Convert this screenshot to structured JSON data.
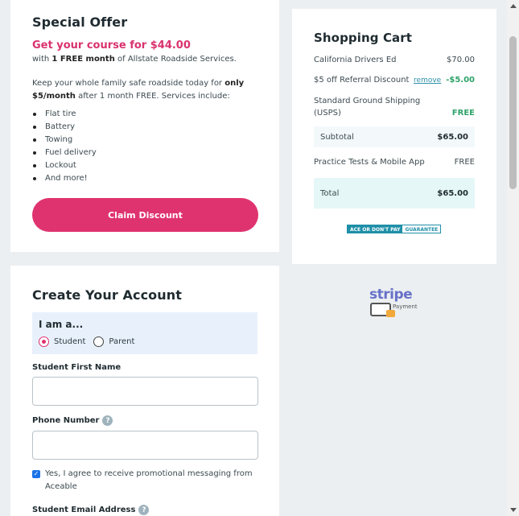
{
  "offer": {
    "title": "Special Offer",
    "price_line": "Get your course for $44.00",
    "sub_prefix": "with ",
    "sub_bold": "1 FREE month",
    "sub_suffix": " of Allstate Roadside Services.",
    "body_prefix": "Keep your whole family safe roadside today for ",
    "body_bold": "only $5/month",
    "body_suffix": " after 1 month FREE. Services include:",
    "services": [
      "Flat tire",
      "Battery",
      "Towing",
      "Fuel delivery",
      "Lockout",
      "And more!"
    ],
    "button_label": "Claim Discount"
  },
  "cart": {
    "title": "Shopping Cart",
    "item_name": "California Drivers Ed",
    "item_price": "$70.00",
    "referral_label": "$5 off Referral Discount",
    "remove_label": "remove",
    "referral_amount": "-$5.00",
    "shipping_label": "Standard Ground Shipping (USPS)",
    "shipping_amount": "FREE",
    "subtotal_label": "Subtotal",
    "subtotal_amount": "$65.00",
    "practice_label": "Practice Tests & Mobile App",
    "practice_amount": "FREE",
    "total_label": "Total",
    "total_amount": "$65.00",
    "guarantee_left": "ACE OR DON'T PAY",
    "guarantee_right": "GUARANTEE"
  },
  "stripe": {
    "logo_text": "stripe",
    "payment_label": "Payment"
  },
  "account": {
    "title": "Create Your Account",
    "iam_label": "I am a...",
    "role_student": "Student",
    "role_parent": "Parent",
    "first_name_label": "Student First Name",
    "first_name_value": "",
    "phone_label": "Phone Number",
    "phone_value": "",
    "help_glyph": "?",
    "consent_text": "Yes, I agree to receive promotional messaging from Aceable",
    "email_label": "Student Email Address"
  },
  "colors": {
    "accent": "#df336f",
    "green": "#2fa36b",
    "teal": "#1f8fa8"
  }
}
